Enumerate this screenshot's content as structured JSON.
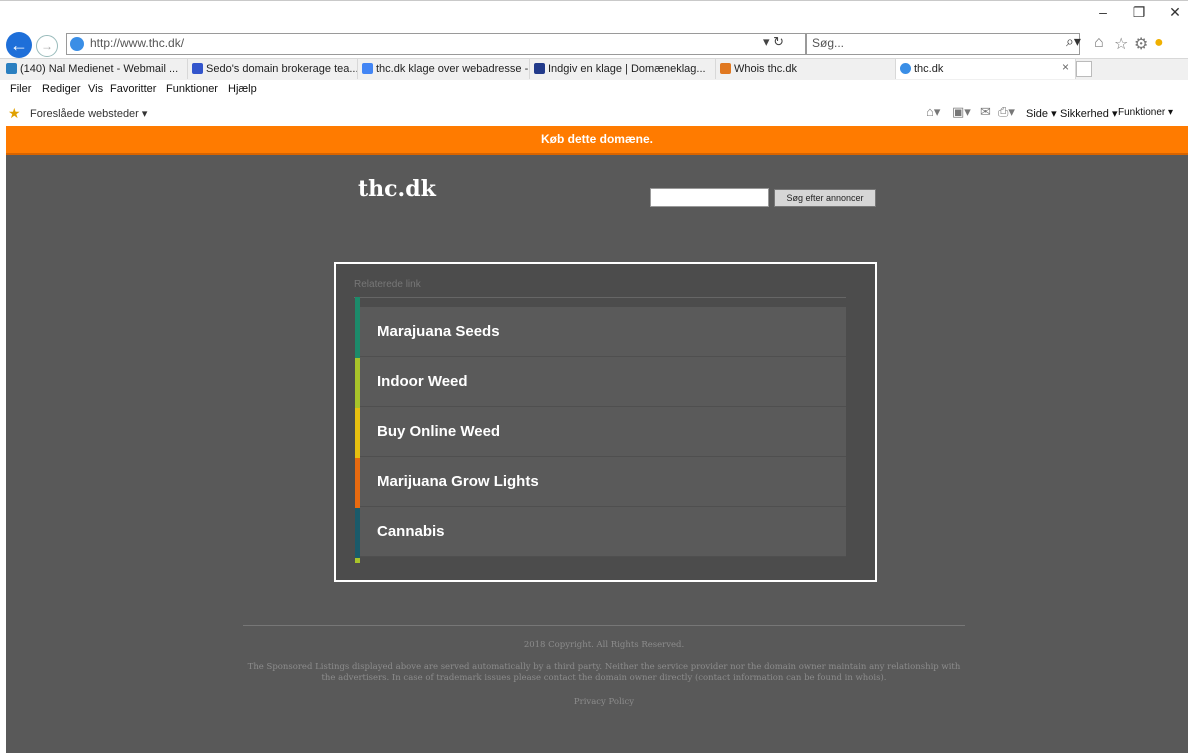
{
  "browser": {
    "address_url": "http://www.thc.dk/",
    "search_placeholder": "Søg...",
    "tabs": [
      {
        "label": "(140) Nal Medienet - Webmail ...",
        "icon": "webmail-icon"
      },
      {
        "label": "Sedo's domain brokerage tea...",
        "icon": "sedo-icon"
      },
      {
        "label": "thc.dk klage over webadresse -...",
        "icon": "google-icon"
      },
      {
        "label": "Indgiv en klage | Domæneklag...",
        "icon": "domaeneklag-icon"
      },
      {
        "label": "Whois thc.dk",
        "icon": "whois-icon"
      },
      {
        "label": "thc.dk",
        "icon": "ie-icon",
        "active": true
      }
    ],
    "menu": [
      "Filer",
      "Rediger",
      "Vis",
      "Favoritter",
      "Funktioner",
      "Hjælp"
    ],
    "favorites_label": "Foreslåede websteder ▾",
    "command_bar": [
      "Side ▾",
      "Sikkerhed ▾",
      "Funktioner ▾"
    ]
  },
  "page": {
    "banner": "Køb dette domæne.",
    "site_title": "thc.dk",
    "search_button": "Søg efter annoncer",
    "related_heading": "Relaterede link",
    "links": [
      {
        "label": "Marajuana Seeds",
        "color": "#1c8a6a"
      },
      {
        "label": "Indoor Weed",
        "color": "#a8c42a"
      },
      {
        "label": "Buy Online Weed",
        "color": "#e8c010"
      },
      {
        "label": "Marijuana Grow Lights",
        "color": "#e86a10"
      },
      {
        "label": "Cannabis",
        "color": "#1a5a6a"
      }
    ],
    "copyright": "2018 Copyright. All Rights Reserved.",
    "disclaimer": "The Sponsored Listings displayed above are served automatically by a third party. Neither the service provider nor the domain owner maintain any relationship with the advertisers. In case of trademark issues please contact the domain owner directly (contact information can be found in whois).",
    "privacy": "Privacy Policy"
  },
  "colors": {
    "banner": "#ff7b00",
    "page_bg": "#595959"
  }
}
